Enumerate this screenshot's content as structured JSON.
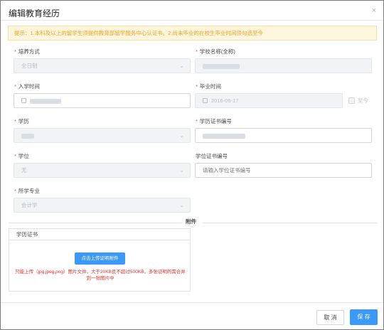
{
  "dialog": {
    "title": "编辑教育经历",
    "close_glyph": "×"
  },
  "notice": "提示：1.本科及以上的留学生须提供教育部留学服务中心认证书。2.尚未毕业的在校生毕业时间须勾选至今",
  "form": {
    "training_mode": {
      "label": "培养方式",
      "value": "全日制"
    },
    "school_name": {
      "label": "学校名称(全称)"
    },
    "enroll_time": {
      "label": "入学时间"
    },
    "graduate_time": {
      "label": "毕业时间",
      "value": "2016-06-17",
      "until_now_label": "至今"
    },
    "education": {
      "label": "学历"
    },
    "education_cert_no": {
      "label": "学历证书编号"
    },
    "degree": {
      "label": "学位",
      "value": "无"
    },
    "degree_cert_no": {
      "label": "学位证书编号",
      "placeholder": "请输入学位证书编号"
    },
    "major": {
      "label": "所学专业",
      "value": "会计学"
    }
  },
  "attachments": {
    "divider_label": "附件",
    "box_title": "学历证书",
    "upload_button": "点击上传证明附件",
    "hint": "只能上传（jpg,jpeg,png）图片文件，大于20KB且不超过500KB，多张证明的需合并到一张图片中"
  },
  "footer": {
    "cancel": "取 消",
    "save": "保 存"
  },
  "colors": {
    "primary": "#3b9af7",
    "required": "#f05050",
    "notice_bg": "#fdf6dd",
    "notice_text": "#f0a020",
    "hint_red": "#e8302a"
  }
}
